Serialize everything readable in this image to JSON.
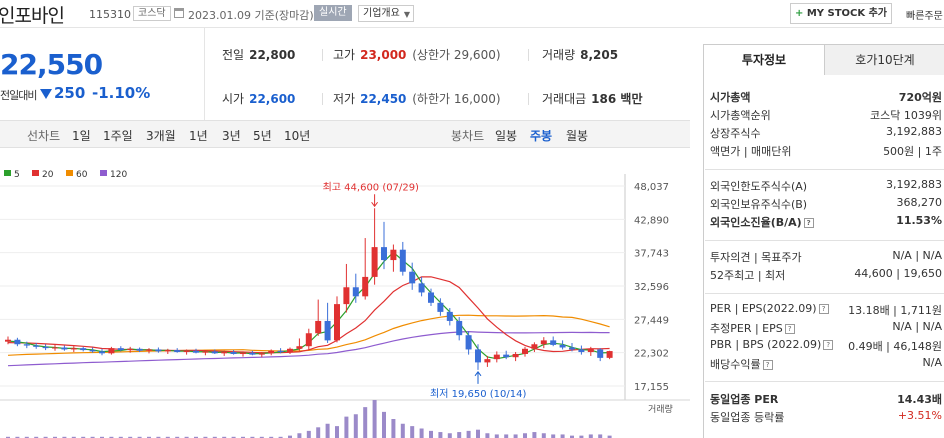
{
  "header": {
    "name": "인포바인",
    "code": "115310",
    "market": "코스닥",
    "date_text": "2023.01.09  기준(장마감)",
    "realtime_label": "실시간",
    "overview_label": "기업개요",
    "mystock_label": "MY STOCK 추가",
    "quick_label": "빠른주문"
  },
  "price": {
    "current": "22,550",
    "change_label": "전일대비",
    "change_value": "250",
    "change_pct": "-1.10%",
    "prev_close_label": "전일",
    "prev_close": "22,800",
    "high_label": "고가",
    "high": "23,000",
    "upper_limit": "(상한가 29,600)",
    "volume_label": "거래량",
    "volume": "8,205",
    "open_label": "시가",
    "open": "22,600",
    "low_label": "저가",
    "low": "22,450",
    "lower_limit": "(하한가 16,000)",
    "amount_label": "거래대금",
    "amount": "186 백만"
  },
  "period_bar": {
    "line_chart_label": "선차트",
    "line_periods": [
      "1일",
      "1주일",
      "3개월",
      "1년",
      "3년",
      "5년",
      "10년"
    ],
    "candle_label": "봉차트",
    "candle_periods": [
      "일봉",
      "주봉",
      "월봉"
    ],
    "active_candle": "주봉"
  },
  "chart_data": {
    "type": "candlestick",
    "y_ticks": [
      "48,037",
      "42,890",
      "37,743",
      "32,596",
      "27,449",
      "22,302",
      "17,155"
    ],
    "ylim": [
      17155,
      48037
    ],
    "ma_legend": [
      {
        "name": "5",
        "color": "#2ca02c"
      },
      {
        "name": "20",
        "color": "#e03131"
      },
      {
        "name": "60",
        "color": "#f08c00"
      },
      {
        "name": "120",
        "color": "#8e5ccf"
      }
    ],
    "annotations": {
      "high": "최고 44,600 (07/29)",
      "low": "최저 19,650 (10/14)"
    },
    "volume_label": "거래량",
    "candles": [
      [
        24000,
        24800,
        23600,
        24300
      ],
      [
        24300,
        24600,
        23300,
        23600
      ],
      [
        23600,
        24000,
        23000,
        23400
      ],
      [
        23400,
        23800,
        22900,
        23200
      ],
      [
        23200,
        23600,
        22700,
        23000
      ],
      [
        23000,
        23500,
        22600,
        23100
      ],
      [
        23100,
        23400,
        22600,
        22800
      ],
      [
        22800,
        23300,
        22400,
        23000
      ],
      [
        23000,
        23200,
        22500,
        22700
      ],
      [
        22700,
        23100,
        22300,
        22500
      ],
      [
        22500,
        22900,
        21900,
        22200
      ],
      [
        22200,
        23200,
        22000,
        23000
      ],
      [
        23000,
        23300,
        22500,
        22700
      ],
      [
        22700,
        23200,
        22300,
        22900
      ],
      [
        22900,
        23100,
        22400,
        22600
      ],
      [
        22600,
        23000,
        22200,
        22800
      ],
      [
        22800,
        23100,
        22300,
        22500
      ],
      [
        22500,
        22900,
        22100,
        22700
      ],
      [
        22700,
        23000,
        22300,
        22400
      ],
      [
        22400,
        22800,
        22000,
        22600
      ],
      [
        22600,
        22900,
        22200,
        22300
      ],
      [
        22300,
        22700,
        21900,
        22500
      ],
      [
        22500,
        22800,
        22100,
        22200
      ],
      [
        22200,
        22600,
        21800,
        22400
      ],
      [
        22400,
        22700,
        22000,
        22100
      ],
      [
        22100,
        22500,
        21700,
        22300
      ],
      [
        22300,
        22600,
        21900,
        22000
      ],
      [
        22000,
        22400,
        21600,
        22200
      ],
      [
        22200,
        22800,
        21900,
        22600
      ],
      [
        22600,
        23000,
        22200,
        22400
      ],
      [
        22400,
        23100,
        22100,
        22900
      ],
      [
        22900,
        24500,
        22600,
        23300
      ],
      [
        23300,
        26000,
        22800,
        25300
      ],
      [
        25300,
        30500,
        24900,
        27200
      ],
      [
        27200,
        30000,
        23800,
        24200
      ],
      [
        24200,
        31000,
        23900,
        29800
      ],
      [
        29800,
        36000,
        28500,
        32400
      ],
      [
        32400,
        34500,
        30000,
        31000
      ],
      [
        31000,
        40000,
        30500,
        34000
      ],
      [
        34000,
        44600,
        32800,
        38600
      ],
      [
        38600,
        42500,
        35200,
        36600
      ],
      [
        36600,
        39000,
        34800,
        38200
      ],
      [
        38200,
        39400,
        34200,
        34800
      ],
      [
        34800,
        36200,
        32000,
        33000
      ],
      [
        33000,
        34000,
        31000,
        31600
      ],
      [
        31600,
        32200,
        29500,
        30000
      ],
      [
        30000,
        30700,
        28000,
        28600
      ],
      [
        28600,
        29200,
        26500,
        27200
      ],
      [
        27200,
        27800,
        24200,
        25000
      ],
      [
        25000,
        25600,
        22000,
        22800
      ],
      [
        22800,
        23600,
        19650,
        20800
      ],
      [
        20800,
        21800,
        20100,
        21300
      ],
      [
        21300,
        22500,
        20800,
        22000
      ],
      [
        22000,
        22600,
        21300,
        21600
      ],
      [
        21600,
        22400,
        21000,
        22100
      ],
      [
        22100,
        23200,
        21700,
        22900
      ],
      [
        22900,
        23900,
        22400,
        23600
      ],
      [
        23600,
        24700,
        23000,
        24200
      ],
      [
        24200,
        24800,
        23300,
        23500
      ],
      [
        23500,
        24200,
        22800,
        23100
      ],
      [
        23100,
        23800,
        22500,
        22800
      ],
      [
        22800,
        23400,
        22000,
        22400
      ],
      [
        22400,
        23200,
        21800,
        22900
      ],
      [
        22800,
        23000,
        21000,
        21500
      ],
      [
        21500,
        22600,
        21300,
        22550
      ]
    ],
    "volumes": [
      1,
      1,
      1,
      1,
      1,
      1,
      1,
      1,
      1,
      1,
      1,
      1,
      1,
      1,
      1,
      1,
      1,
      1,
      1,
      1,
      1,
      1,
      1,
      1,
      1,
      1,
      1,
      1,
      1,
      1,
      2,
      4,
      6,
      9,
      12,
      10,
      18,
      20,
      26,
      32,
      22,
      16,
      12,
      10,
      8,
      6,
      5,
      4,
      5,
      6,
      7,
      4,
      3,
      3,
      3,
      4,
      5,
      4,
      3,
      3,
      2,
      2,
      3,
      3,
      2
    ]
  },
  "info_panel": {
    "tabs": [
      "투자정보",
      "호가10단계"
    ],
    "rows": [
      {
        "k": "시가총액",
        "v": "720억원",
        "bold": true
      },
      {
        "k": "시가총액순위",
        "v": "코스닥 1039위"
      },
      {
        "k": "상장주식수",
        "v": "3,192,883"
      },
      {
        "k": "액면가 | 매매단위",
        "v": "500원 | 1주"
      },
      {
        "k": "외국인한도주식수(A)",
        "v": "3,192,883"
      },
      {
        "k": "외국인보유주식수(B)",
        "v": "368,270"
      },
      {
        "k": "외국인소진율(B/A)",
        "v": "11.53%",
        "bold": true,
        "q": true
      },
      {
        "k": "투자의견 | 목표주가",
        "v": "N/A | N/A"
      },
      {
        "k": "52주최고 | 최저",
        "v": "44,600 | 19,650"
      },
      {
        "k": "PER | EPS(2022.09)",
        "v": "13.18배 | 1,711원",
        "q": true
      },
      {
        "k": "추정PER | EPS",
        "v": "N/A | N/A",
        "q": true
      },
      {
        "k": "PBR | BPS (2022.09)",
        "v": "0.49배 | 46,148원",
        "q": true
      },
      {
        "k": "배당수익률",
        "v": "N/A",
        "q": true
      },
      {
        "k": "동일업종 PER",
        "v": "14.43배",
        "bold": true
      },
      {
        "k": "동일업종 등락률",
        "v": "+3.51%",
        "red": true
      }
    ]
  }
}
